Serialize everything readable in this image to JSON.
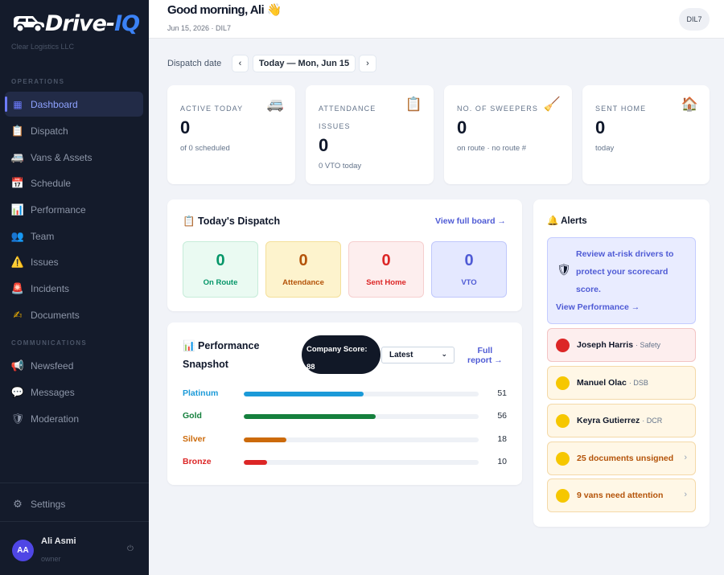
{
  "brand": {
    "logo_name": "Drive-",
    "logo_suffix": "IQ",
    "company": "Clear Logistics LLC"
  },
  "sidebar": {
    "sections": {
      "operations": "OPERATIONS",
      "communications": "COMMUNICATIONS"
    },
    "items": [
      {
        "label": "Dashboard",
        "icon": "grid-icon",
        "glyph": "▦"
      },
      {
        "label": "Dispatch",
        "icon": "clipboard-icon",
        "glyph": "📋"
      },
      {
        "label": "Vans & Assets",
        "icon": "van-icon",
        "glyph": "🚐"
      },
      {
        "label": "Schedule",
        "icon": "calendar-icon",
        "glyph": "📅"
      },
      {
        "label": "Performance",
        "icon": "bar-chart-icon",
        "glyph": "📊"
      },
      {
        "label": "Team",
        "icon": "people-icon",
        "glyph": "👥"
      },
      {
        "label": "Issues",
        "icon": "warning-icon",
        "glyph": "⚠️"
      },
      {
        "label": "Incidents",
        "icon": "siren-icon",
        "glyph": "🚨"
      },
      {
        "label": "Documents",
        "icon": "signature-icon",
        "glyph": "✍"
      },
      {
        "label": "Newsfeed",
        "icon": "megaphone-icon",
        "glyph": "📢"
      },
      {
        "label": "Messages",
        "icon": "chat-icon",
        "glyph": "💬"
      },
      {
        "label": "Moderation",
        "icon": "shield-icon",
        "glyph": "🛡"
      }
    ],
    "settings": "Settings",
    "user": {
      "initials": "AA",
      "name": "Ali Asmi",
      "role": "owner"
    }
  },
  "header": {
    "greeting": "Good morning, Ali 👋",
    "date_line": "Jun 15, 2026 · DIL7",
    "station": "DIL7"
  },
  "dispatch_date": {
    "label": "Dispatch date",
    "prev": "‹",
    "current": "Today — Mon, Jun 15",
    "next": "›"
  },
  "stats": {
    "active": {
      "label": "ACTIVE TODAY",
      "value": "0",
      "sub": "of 0 scheduled"
    },
    "attendance": {
      "label": "ATTENDANCE ISSUES",
      "value": "0",
      "sub": "0 VTO today"
    },
    "sweepers": {
      "label": "NO. OF SWEEPERS",
      "value": "0",
      "sub": "on route · no route #"
    },
    "sent_home": {
      "label": "SENT HOME",
      "value": "0",
      "sub": "today"
    }
  },
  "todays_dispatch": {
    "title": "📋 Today's Dispatch",
    "link": "View full board →",
    "tiles": [
      {
        "value": "0",
        "label": "On Route",
        "color": "#059669"
      },
      {
        "value": "0",
        "label": "Attendance",
        "color": "#b45309"
      },
      {
        "value": "0",
        "label": "Sent Home",
        "color": "#dc2626"
      },
      {
        "value": "0",
        "label": "VTO",
        "color": "#4f5bd5"
      }
    ]
  },
  "performance": {
    "title_line1": "📊 Performance",
    "title_line2": "Snapshot",
    "score_label": "Company Score:",
    "score_value": "88",
    "select_value": "Latest",
    "link_line1": "Full",
    "link_line2": "report →",
    "tiers": [
      {
        "name": "Platinum",
        "value": 51,
        "color": "#1b9ad8"
      },
      {
        "name": "Gold",
        "value": 56,
        "color": "#15803d"
      },
      {
        "name": "Silver",
        "value": 18,
        "color": "#cc6a0a"
      },
      {
        "name": "Bronze",
        "value": 10,
        "color": "#dc2626"
      }
    ]
  },
  "alerts": {
    "title": "🔔 Alerts",
    "hero_text": "Review at-risk drivers to protect your scorecard score.",
    "hero_link": "View Performance →",
    "rows": [
      {
        "name": "Joseph Harris",
        "tag": "· Safety",
        "dot": "#dc2626",
        "bg": "#fdeeee",
        "border": "#f3c4c4",
        "chevron": false
      },
      {
        "name": "Manuel Olac",
        "tag": "· DSB",
        "dot": "#f6c700",
        "bg": "#fff7e6",
        "border": "#f4d9a8",
        "chevron": false
      },
      {
        "name": "Keyra Gutierrez",
        "tag": "· DCR",
        "dot": "#f6c700",
        "bg": "#fff7e6",
        "border": "#f4d9a8",
        "chevron": false
      },
      {
        "name": "25 documents unsigned",
        "tag": "",
        "dot": "#f6c700",
        "bg": "#fff7e6",
        "border": "#f4d9a8",
        "chevron": true
      },
      {
        "name": "9 vans need attention",
        "tag": "",
        "dot": "#f6c700",
        "bg": "#fff7e6",
        "border": "#f4d9a8",
        "chevron": true
      }
    ]
  }
}
